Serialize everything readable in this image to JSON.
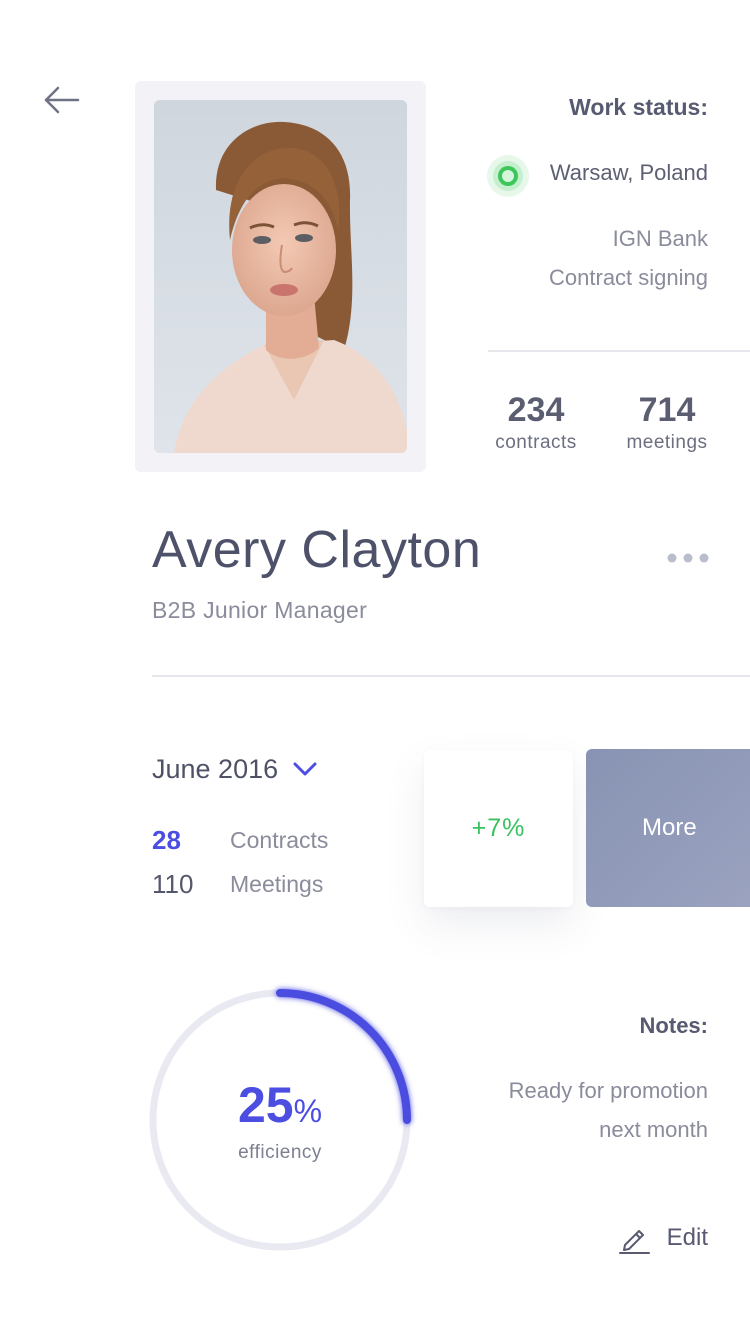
{
  "header": {
    "back_icon": "arrow-left-icon"
  },
  "profile": {
    "photo_icon": "profile-photo",
    "name": "Avery Clayton",
    "role": "B2B Junior Manager"
  },
  "work_status": {
    "title": "Work status:",
    "status_icon": "status-online-icon",
    "status_color": "#3cc75a",
    "location": "Warsaw, Poland",
    "company": "IGN Bank",
    "activity": "Contract signing"
  },
  "stats": {
    "contracts": {
      "value": "234",
      "label": "contracts"
    },
    "meetings": {
      "value": "714",
      "label": "meetings"
    }
  },
  "period": {
    "label": "June 2016",
    "chevron_icon": "chevron-down-icon",
    "contracts": {
      "value": "28",
      "label": "Contracts"
    },
    "meetings": {
      "value": "110",
      "label": "Meetings"
    }
  },
  "growth": {
    "value": "+7%"
  },
  "more_button": {
    "label": "More"
  },
  "efficiency": {
    "value": "25",
    "unit": "%",
    "label": "efficiency",
    "fraction": 0.25,
    "accent_color": "#4b4ee0"
  },
  "notes": {
    "title": "Notes:",
    "line1": "Ready for promotion",
    "line2": "next month",
    "edit_icon": "pencil-icon",
    "edit_label": "Edit"
  },
  "colors": {
    "accent": "#4b4ee0",
    "positive": "#39c25f",
    "text_primary": "#4e516a",
    "text_muted": "#8a8c9c"
  }
}
